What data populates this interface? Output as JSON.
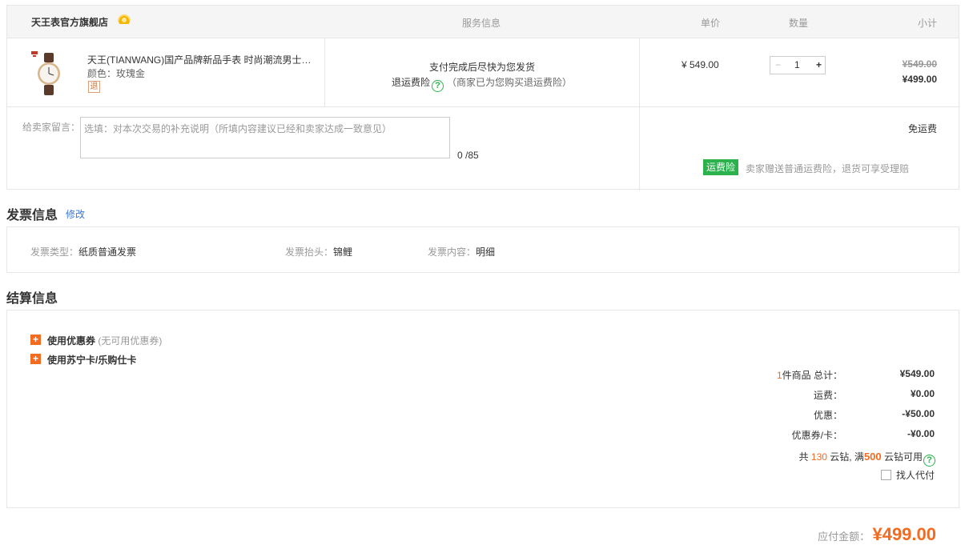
{
  "order": {
    "shop_name": "天王表官方旗舰店",
    "headers": {
      "service": "服务信息",
      "unit_price": "单价",
      "quantity": "数量",
      "subtotal": "小计"
    },
    "item": {
      "title": "天王(TIANWANG)国产品牌新品手表 时尚潮流男士…",
      "color": "颜色：玫瑰金",
      "return_badge": "退",
      "service_line1": "支付完成后尽快为您发货",
      "insurance_label": "退运费险",
      "insurance_note": "（商家已为您购买退运费险）",
      "unit_price": "¥ 549.00",
      "qty_minus": "−",
      "qty": "1",
      "qty_plus": "+",
      "orig_subtotal": "¥549.00",
      "subtotal": "¥499.00"
    },
    "memo": {
      "label": "给卖家留言：",
      "placeholder": "选填：对本次交易的补充说明（所填内容建议已经和卖家达成一致意见）",
      "count": "0 /85"
    },
    "shipping": {
      "free": "免运费",
      "ins_badge": "运费险",
      "ins_text": "卖家赠送普通运费险，退货可享受理赔"
    }
  },
  "invoice": {
    "title": "发票信息",
    "edit": "修改",
    "type_label": "发票类型：",
    "type_value": "纸质普通发票",
    "header_label": "发票抬头：",
    "header_value": "锦鲤",
    "content_label": "发票内容：",
    "content_value": "明细"
  },
  "settle": {
    "title": "结算信息",
    "coupon_label": "使用优惠券",
    "coupon_note": "(无可用优惠券)",
    "card_label": "使用苏宁卡/乐购仕卡",
    "count_num": "1",
    "count_text": "件商品  总计：",
    "total_value": "¥549.00",
    "freight_label": "运费：",
    "freight_value": "¥0.00",
    "discount_label": "优惠：",
    "discount_value": "-¥50.00",
    "coupon_card_label": "优惠券/卡：",
    "coupon_card_value": "-¥0.00",
    "coin_prefix": "共",
    "coin_count": "130",
    "coin_mid": "云钻, 满",
    "coin_threshold": "500",
    "coin_suffix": "云钻可用",
    "proxy_label": "找人代付"
  },
  "payable": {
    "label": "应付金额：",
    "value": "¥499.00"
  },
  "colors": {
    "accent": "#f26b21",
    "green": "#2bb24c",
    "link": "#3a76d8",
    "border": "#e6e6e6"
  }
}
